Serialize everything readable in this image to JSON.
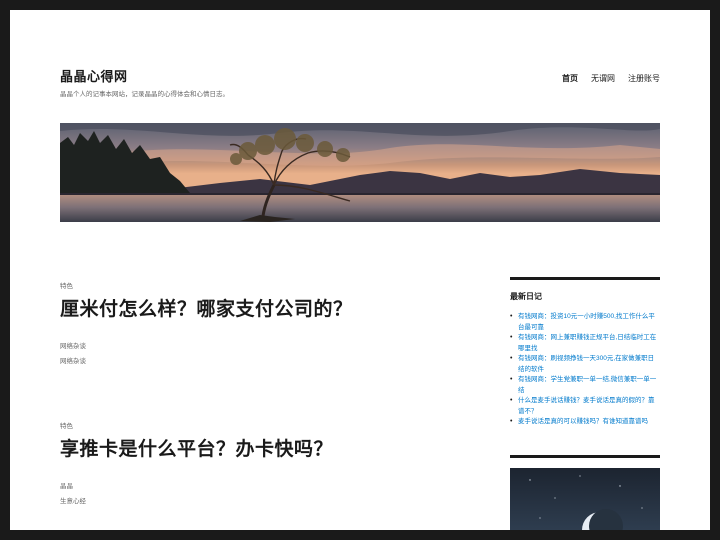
{
  "site": {
    "title": "晶晶心得网",
    "description": "晶晶个人的记事本网站，记录晶晶的心得体会和心情日志。"
  },
  "nav": {
    "items": [
      {
        "label": "首页",
        "active": true
      },
      {
        "label": "无谓网",
        "active": false
      },
      {
        "label": "注册账号",
        "active": false
      }
    ]
  },
  "posts": [
    {
      "tag": "特色",
      "title": "厘米付怎么样？哪家支付公司的？",
      "meta1": "网络杂谈",
      "meta2": "网络杂谈"
    },
    {
      "tag": "特色",
      "title": "享推卡是什么平台？办卡快吗？",
      "meta1": "晶晶",
      "meta2": "生意心经"
    }
  ],
  "sidebar": {
    "heading": "最新日记",
    "items": [
      "有钱网商：投资10元一小时赚500,找工作什么平台最可靠",
      "有钱网商：网上兼职赚钱正规平台,日结临时工在哪里找",
      "有钱网商：刷视频挣钱一天300元,在家做兼职日结的软件",
      "有钱网商：学生党兼职一单一结,微信兼职一单一结",
      "什么是麦手说话赚钱？麦手说话是真的假的？靠谱不？",
      "麦手说话是真的可以赚钱吗？有谁知道靠谱吗"
    ]
  },
  "colors": {
    "link": "#007acc",
    "text": "#1a1a1a",
    "muted": "#686868",
    "frame": "#1a1a1a"
  }
}
